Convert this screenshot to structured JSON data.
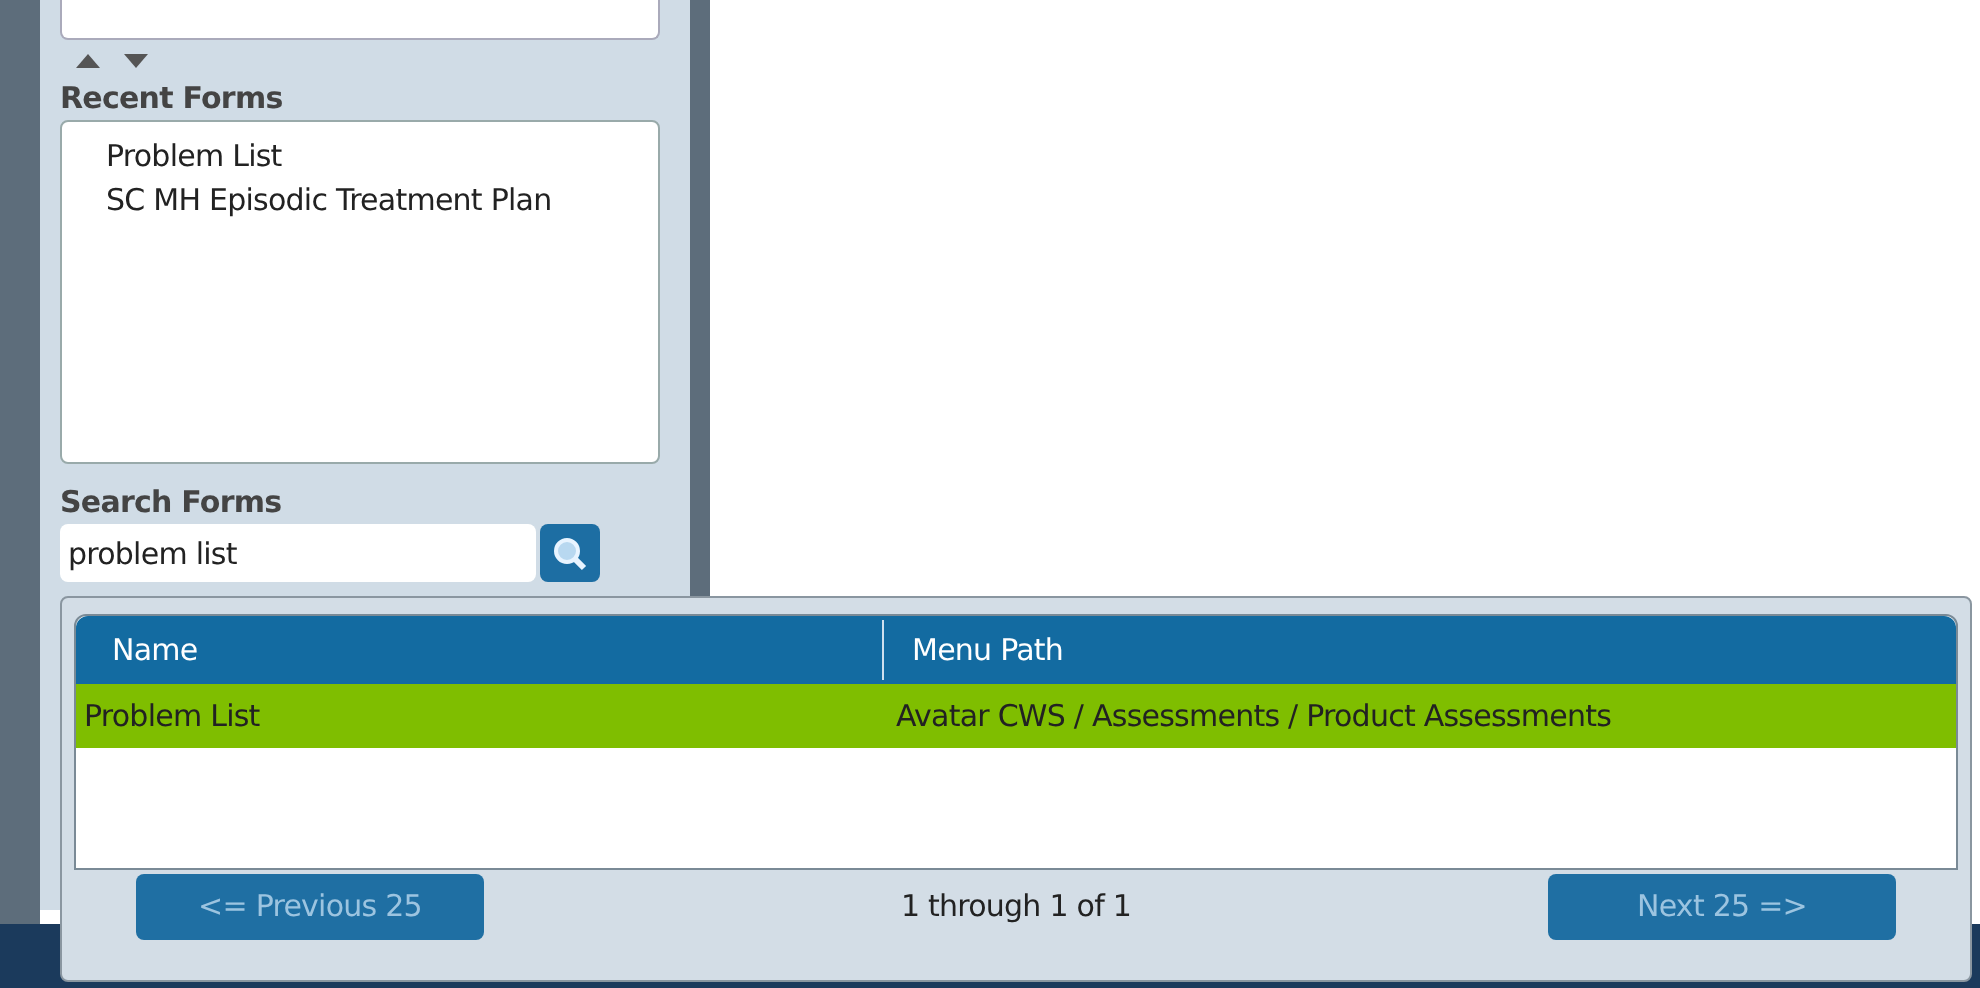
{
  "recent_forms": {
    "title": "Recent Forms",
    "items": [
      {
        "label": "Problem List"
      },
      {
        "label": "SC MH Episodic Treatment Plan"
      }
    ]
  },
  "search_forms": {
    "title": "Search Forms",
    "value": "problem list"
  },
  "results": {
    "columns": [
      "Name",
      "Menu Path"
    ],
    "rows": [
      {
        "cells": [
          "Problem List",
          "Avatar CWS / Assessments / Product Assessments"
        ],
        "selected": true
      }
    ],
    "previous_button": {
      "label": "<= Previous 25",
      "disabled": true
    },
    "range": "1 through 1 of 1",
    "next_button": {
      "label": "Next 25 =>",
      "disabled": true
    }
  }
}
